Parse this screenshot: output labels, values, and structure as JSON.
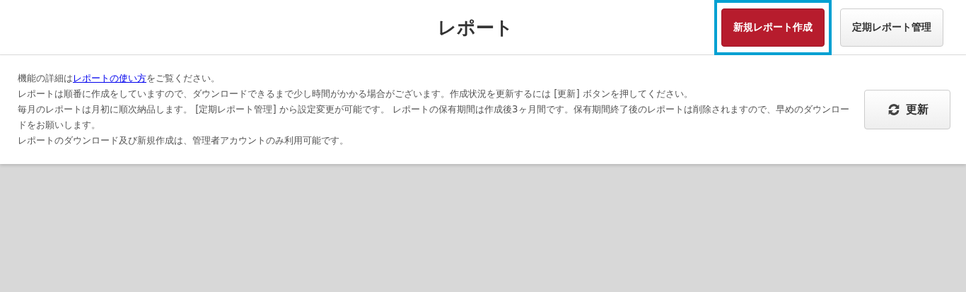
{
  "header": {
    "title": "レポート",
    "buttons": [
      {
        "label": "新規レポート作成",
        "kind": "primary",
        "highlighted": true
      },
      {
        "label": "定期レポート管理",
        "kind": "secondary",
        "highlighted": false
      }
    ]
  },
  "notice": {
    "paragraphs": [
      {
        "before": "機能の詳細は",
        "link": "レポートの使い方",
        "after": "をご覧ください。"
      },
      {
        "before": "レポートは順番に作成をしていますので、ダウンロードできるまで少し時間がかかる場合がございます。作成状況を更新するには [更新] ボタンを押してください。"
      },
      {
        "before": "毎月のレポートは月初に順次納品します。 [定期レポート管理] から設定変更が可能です。 レポートの保有期間は作成後3ヶ月間です。保有期間終了後のレポートは削除されますので、早めのダウンロードをお願いします。"
      },
      {
        "before": "レポートのダウンロード及び新規作成は、管理者アカウントのみ利用可能です。"
      }
    ]
  },
  "refresh_button": {
    "label": "更新"
  }
}
